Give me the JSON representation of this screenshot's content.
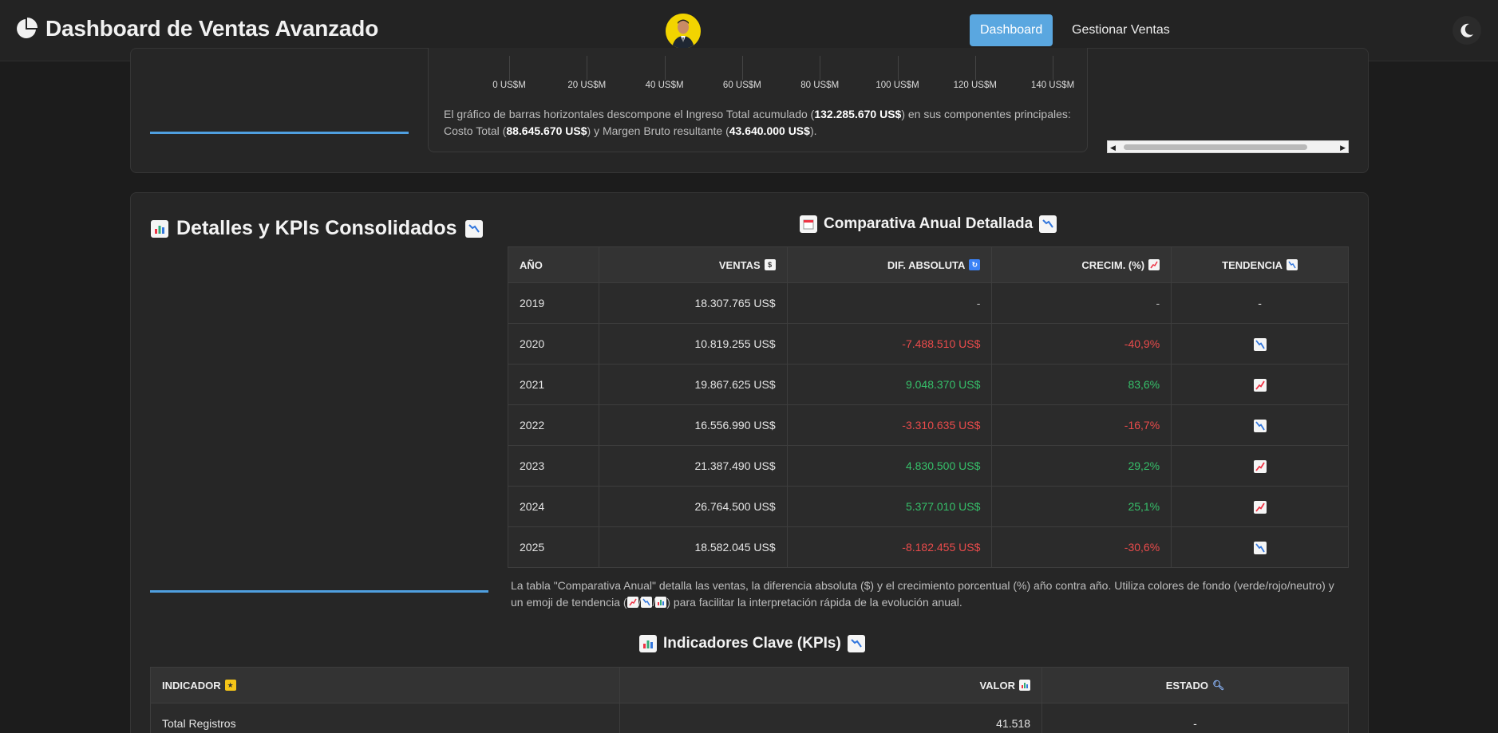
{
  "navbar": {
    "title": "Dashboard de Ventas Avanzado",
    "dashboard_label": "Dashboard",
    "manage_label": "Gestionar Ventas"
  },
  "top_card": {
    "axis_ticks": [
      "0 US$M",
      "20 US$M",
      "40 US$M",
      "60 US$M",
      "80 US$M",
      "100 US$M",
      "120 US$M",
      "140 US$M"
    ],
    "desc_part1": "El gráfico de barras horizontales descompone el Ingreso Total acumulado (",
    "total_income": "132.285.670 US$",
    "desc_part2": ") en sus componentes principales: Costo Total (",
    "total_cost": "88.645.670 US$",
    "desc_part3": ") y Margen Bruto resultante (",
    "gross_margin": "43.640.000 US$",
    "desc_part4": ")."
  },
  "details": {
    "title": "Detalles y KPIs Consolidados",
    "annual_title": "Comparativa Anual Detallada",
    "headers": {
      "year": "AÑO",
      "sales": "VENTAS",
      "abs_diff": "DIF. ABSOLUTA",
      "growth": "CRECIM. (%)",
      "trend": "TENDENCIA"
    },
    "rows": [
      {
        "year": "2019",
        "sales": "18.307.765 US$",
        "diff": "-",
        "growth": "-",
        "trend": "-",
        "dir": "none"
      },
      {
        "year": "2020",
        "sales": "10.819.255 US$",
        "diff": "-7.488.510 US$",
        "growth": "-40,9%",
        "trend": "",
        "dir": "down"
      },
      {
        "year": "2021",
        "sales": "19.867.625 US$",
        "diff": "9.048.370 US$",
        "growth": "83,6%",
        "trend": "",
        "dir": "up"
      },
      {
        "year": "2022",
        "sales": "16.556.990 US$",
        "diff": "-3.310.635 US$",
        "growth": "-16,7%",
        "trend": "",
        "dir": "down"
      },
      {
        "year": "2023",
        "sales": "21.387.490 US$",
        "diff": "4.830.500 US$",
        "growth": "29,2%",
        "trend": "",
        "dir": "up"
      },
      {
        "year": "2024",
        "sales": "26.764.500 US$",
        "diff": "5.377.010 US$",
        "growth": "25,1%",
        "trend": "",
        "dir": "up"
      },
      {
        "year": "2025",
        "sales": "18.582.045 US$",
        "diff": "-8.182.455 US$",
        "growth": "-30,6%",
        "trend": "",
        "dir": "down"
      }
    ],
    "table_desc_part1": "La tabla \"Comparativa Anual\" detalla las ventas, la diferencia absoluta ($) y el crecimiento porcentual (%) año contra año. Utiliza colores de fondo (verde/rojo/neutro) y un emoji de tendencia (",
    "table_desc_sep": "/",
    "table_desc_part2": ") para facilitar la interpretación rápida de la evolución anual.",
    "kpi_title": "Indicadores Clave (KPIs)",
    "kpi_headers": {
      "indicator": "INDICADOR",
      "value": "VALOR",
      "status": "ESTADO"
    },
    "kpi_rows": [
      {
        "indicator": "Total Registros",
        "value": "41.518",
        "status": "-"
      }
    ]
  },
  "colors": {
    "accent": "#5aa7e0",
    "negative": "#ea4b4b",
    "positive": "#36c06a",
    "background": "#1c1c1c"
  }
}
